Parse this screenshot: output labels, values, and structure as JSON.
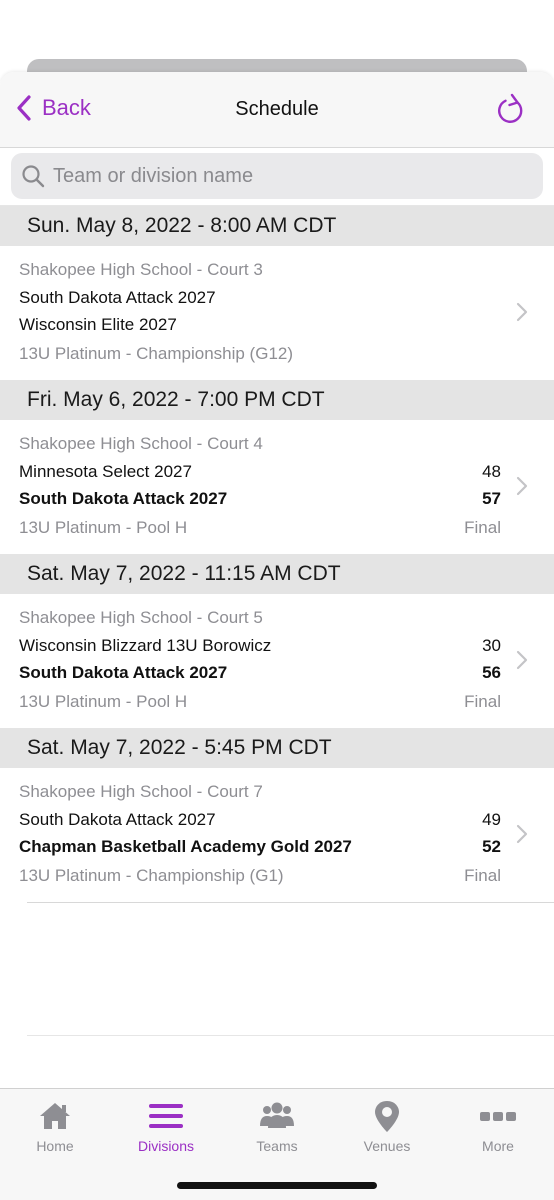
{
  "navbar": {
    "back_label": "Back",
    "title": "Schedule"
  },
  "search": {
    "placeholder": "Team or division name",
    "value": ""
  },
  "sections": [
    {
      "header": "Sun. May 8, 2022 - 8:00 AM CDT",
      "venue": "Shakopee High School - Court 3",
      "team1": "South Dakota Attack 2027",
      "team2": "Wisconsin Elite 2027",
      "division": "13U Platinum - Championship (G12)",
      "score1": "",
      "score2": "",
      "status": ""
    },
    {
      "header": "Fri. May 6, 2022 - 7:00 PM CDT",
      "venue": "Shakopee High School - Court 4",
      "team1": "Minnesota Select 2027",
      "team2": "South Dakota Attack 2027",
      "division": "13U Platinum - Pool H",
      "score1": "48",
      "score2": "57",
      "status": "Final"
    },
    {
      "header": "Sat. May 7, 2022 - 11:15 AM CDT",
      "venue": "Shakopee High School - Court 5",
      "team1": "Wisconsin Blizzard 13U Borowicz",
      "team2": "South Dakota Attack 2027",
      "division": "13U Platinum - Pool H",
      "score1": "30",
      "score2": "56",
      "status": "Final"
    },
    {
      "header": "Sat. May 7, 2022 - 5:45 PM CDT",
      "venue": "Shakopee High School - Court 7",
      "team1": "South Dakota Attack 2027",
      "team2": "Chapman Basketball Academy Gold 2027",
      "division": "13U Platinum - Championship (G1)",
      "score1": "49",
      "score2": "52",
      "status": "Final"
    }
  ],
  "tabs": [
    {
      "label": "Home",
      "icon": "home-icon"
    },
    {
      "label": "Divisions",
      "icon": "list-icon",
      "active": true
    },
    {
      "label": "Teams",
      "icon": "people-icon"
    },
    {
      "label": "Venues",
      "icon": "map-pin-icon"
    },
    {
      "label": "More",
      "icon": "more-icon"
    }
  ],
  "colors": {
    "accent": "#9b30c4",
    "inactive": "#8e8e93",
    "section_bg": "#e4e4e4"
  }
}
